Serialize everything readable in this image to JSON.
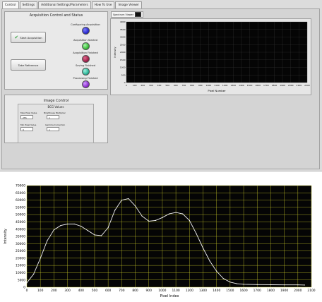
{
  "tabs": [
    "Control",
    "Settings",
    "Additional Settings/Parameters",
    "How To Use",
    "Image Viewer"
  ],
  "acquisition": {
    "title": "Acquisition Control and Status",
    "start_label": "Start Acquisition",
    "reference_label": "Take Reference",
    "status": [
      {
        "label": "Configuring Acquisition",
        "color": "#2b2bd0"
      },
      {
        "label": "Acquisition Started",
        "color": "#3cbf3c"
      },
      {
        "label": "Acquisition Finished",
        "color": "#a0204a"
      },
      {
        "label": "Saving Finished",
        "color": "#2fb89a"
      },
      {
        "label": "Processing Finished",
        "color": "#8e2fd0"
      }
    ]
  },
  "image_control": {
    "title": "Image Control",
    "bcg_title": "BCG Values",
    "max_pixel_label": "Max Pixel Value",
    "max_pixel_value": "255",
    "brightness_label": "Brightness Multiplier",
    "brightness_value": "1",
    "min_pixel_label": "Min Pixel Value",
    "min_pixel_value": "0",
    "gamma_label": "Gamma Correction",
    "gamma_value": "1"
  },
  "spectrum_legend": "Spectrum Viewer",
  "small_chart": {
    "ylabel": "Intensity",
    "xlabel": "Pixel Number",
    "yticks": [
      "4000",
      "3500",
      "3000",
      "2500",
      "2000",
      "1500",
      "1000",
      "500",
      "0"
    ],
    "xticks": [
      "0",
      "100",
      "200",
      "300",
      "400",
      "500",
      "600",
      "700",
      "800",
      "900",
      "1000",
      "1100",
      "1200",
      "1300",
      "1400",
      "1500",
      "1600",
      "1700",
      "1800",
      "1900",
      "2000",
      "2100",
      "2200"
    ]
  },
  "chart_data": {
    "type": "line",
    "xlabel": "Pixel Index",
    "ylabel": "Intensity",
    "xlim": [
      0,
      2100
    ],
    "ylim": [
      0,
      70000
    ],
    "xticks": [
      0,
      100,
      200,
      300,
      400,
      500,
      600,
      700,
      800,
      900,
      1000,
      1100,
      1200,
      1300,
      1400,
      1500,
      1600,
      1700,
      1800,
      1900,
      2000,
      2100
    ],
    "yticks": [
      0,
      5000,
      10000,
      15000,
      20000,
      25000,
      30000,
      35000,
      40000,
      45000,
      50000,
      55000,
      60000,
      65000,
      70000
    ],
    "grid": true,
    "x": [
      0,
      50,
      100,
      150,
      200,
      250,
      300,
      350,
      400,
      450,
      500,
      550,
      600,
      650,
      700,
      750,
      800,
      850,
      900,
      950,
      1000,
      1050,
      1100,
      1150,
      1200,
      1250,
      1300,
      1350,
      1400,
      1450,
      1500,
      1550,
      1600,
      1700,
      1800,
      1900,
      2000,
      2050
    ],
    "y": [
      3000,
      9000,
      20000,
      32000,
      39500,
      42500,
      43500,
      43500,
      42000,
      39000,
      36000,
      35500,
      41000,
      53000,
      60000,
      61000,
      56000,
      49000,
      45500,
      46000,
      48000,
      50500,
      51500,
      50500,
      46000,
      37000,
      27000,
      18000,
      11000,
      6000,
      3500,
      2400,
      2000,
      1800,
      1700,
      1600,
      1600,
      1500
    ]
  }
}
